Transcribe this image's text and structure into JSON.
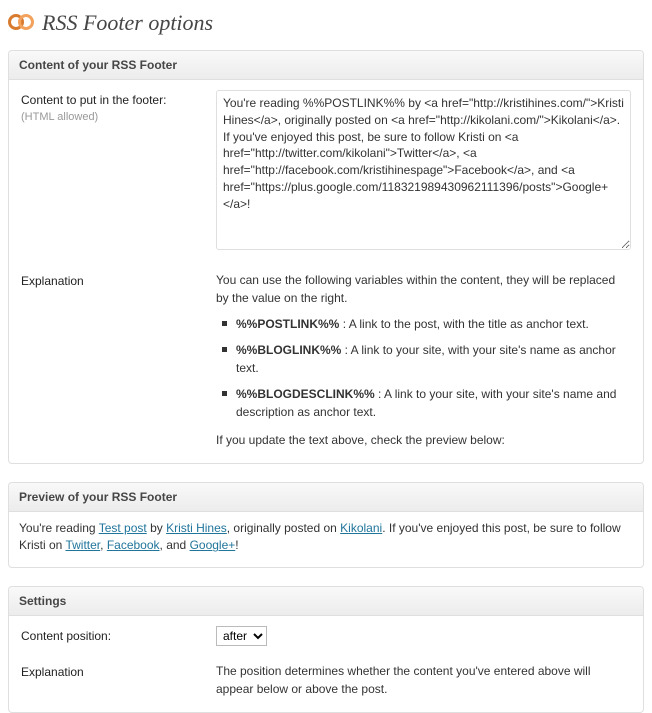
{
  "page": {
    "title": "RSS Footer options",
    "logo_name": "yoast-logo"
  },
  "content_panel": {
    "heading": "Content of your RSS Footer",
    "field_label": "Content to put in the footer:",
    "field_hint": "(HTML allowed)",
    "textarea_value": "You're reading %%POSTLINK%% by <a href=\"http://kristihines.com/\">Kristi Hines</a>, originally posted on <a href=\"http://kikolani.com/\">Kikolani</a>.  If you've enjoyed this post, be sure to follow Kristi on <a href=\"http://twitter.com/kikolani\">Twitter</a>, <a href=\"http://facebook.com/kristihinespage\">Facebook</a>, and <a href=\"https://plus.google.com/118321989430962111396/posts\">Google+</a>!",
    "explanation_label": "Explanation",
    "explanation_intro": "You can use the following variables within the content, they will be replaced by the value on the right.",
    "vars": [
      {
        "code": "%%POSTLINK%%",
        "desc": " : A link to the post, with the title as anchor text."
      },
      {
        "code": "%%BLOGLINK%%",
        "desc": " : A link to your site, with your site's name as anchor text."
      },
      {
        "code": "%%BLOGDESCLINK%%",
        "desc": " : A link to your site, with your site's name and description as anchor text."
      }
    ],
    "explanation_outro": "If you update the text above, check the preview below:"
  },
  "preview_panel": {
    "heading": "Preview of your RSS Footer",
    "text_before_1": "You're reading ",
    "link_testpost": "Test post",
    "text_by": " by ",
    "link_author": "Kristi Hines",
    "text_posted_on": ", originally posted on ",
    "link_site": "Kikolani",
    "text_enjoyed": ". If you've enjoyed this post, be sure to follow Kristi on ",
    "link_twitter": "Twitter",
    "text_comma1": ", ",
    "link_facebook": "Facebook",
    "text_and": ", and ",
    "link_google": "Google+",
    "text_end": "!"
  },
  "settings_panel": {
    "heading": "Settings",
    "position_label": "Content position:",
    "position_value": "after",
    "explanation_label": "Explanation",
    "explanation_text": "The position determines whether the content you've entered above will appear below or above the post."
  }
}
